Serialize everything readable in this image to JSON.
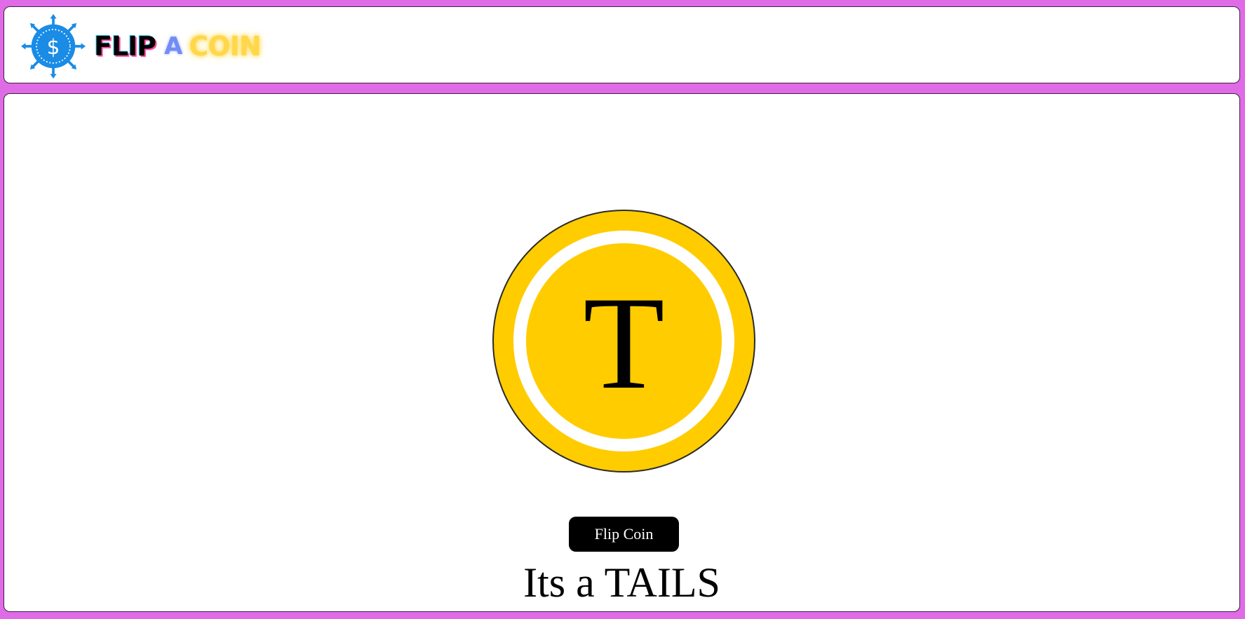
{
  "header": {
    "logo": {
      "icon": "dollar-gear-icon",
      "text_part1": "FLIP",
      "text_part2": "A",
      "text_part3": "COIN"
    }
  },
  "coin": {
    "face_letter": "T",
    "color": "#ffcc00",
    "ring_color": "#ffffff"
  },
  "controls": {
    "flip_button_label": "Flip Coin"
  },
  "result": {
    "text": "Its a TAILS"
  },
  "colors": {
    "background": "#e06be6",
    "panel": "#ffffff",
    "button": "#000000"
  }
}
